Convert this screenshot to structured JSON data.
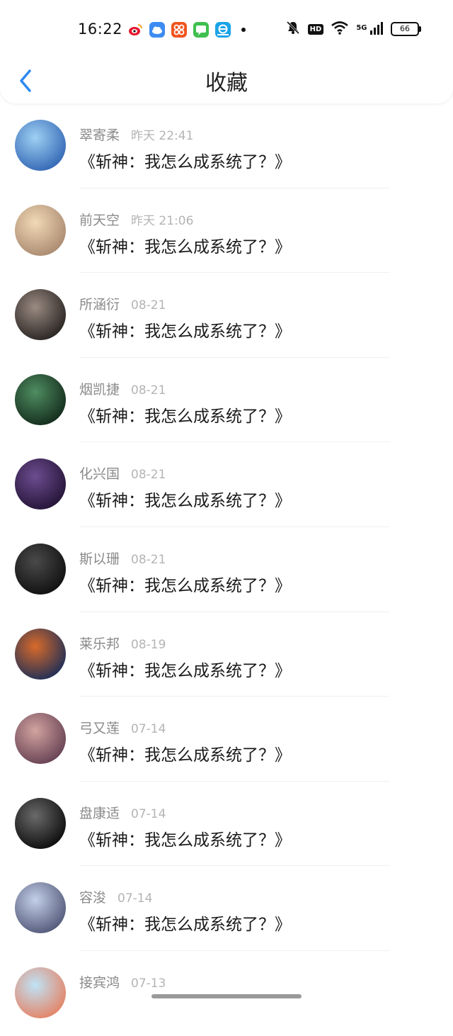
{
  "status_bar": {
    "time": "16:22",
    "hd_label": "HD",
    "network_label": "5G",
    "battery": "66"
  },
  "header": {
    "title": "收藏"
  },
  "items": [
    {
      "name": "翠寄柔",
      "date": "昨天 22:41",
      "message": "《斩神：我怎么成系统了？》",
      "avatar_colors": [
        "#9fd0f3",
        "#2a5fb0"
      ]
    },
    {
      "name": "前天空",
      "date": "昨天 21:06",
      "message": "《斩神：我怎么成系统了？》",
      "avatar_colors": [
        "#f1d9b6",
        "#a4836a"
      ]
    },
    {
      "name": "所涵衍",
      "date": "08-21",
      "message": "《斩神：我怎么成系统了？》",
      "avatar_colors": [
        "#9b8b82",
        "#1f1b1a"
      ]
    },
    {
      "name": "烟凯捷",
      "date": "08-21",
      "message": "《斩神：我怎么成系统了？》",
      "avatar_colors": [
        "#4f8d62",
        "#0f2416"
      ]
    },
    {
      "name": "化兴国",
      "date": "08-21",
      "message": "《斩神：我怎么成系统了？》",
      "avatar_colors": [
        "#6b4c8f",
        "#1f1030"
      ]
    },
    {
      "name": "斯以珊",
      "date": "08-21",
      "message": "《斩神：我怎么成系统了？》",
      "avatar_colors": [
        "#4a4a4a",
        "#0b0b0b"
      ]
    },
    {
      "name": "莱乐邦",
      "date": "08-19",
      "message": "《斩神：我怎么成系统了？》",
      "avatar_colors": [
        "#d86a2a",
        "#102a5a"
      ]
    },
    {
      "name": "弓又莲",
      "date": "07-14",
      "message": "《斩神：我怎么成系统了？》",
      "avatar_colors": [
        "#d2a3a0",
        "#5e3a4d"
      ]
    },
    {
      "name": "盘康适",
      "date": "07-14",
      "message": "《斩神：我怎么成系统了？》",
      "avatar_colors": [
        "#6a6a6a",
        "#050505"
      ]
    },
    {
      "name": "容浚",
      "date": "07-14",
      "message": "《斩神：我怎么成系统了？》",
      "avatar_colors": [
        "#c3cfe8",
        "#4a4f70"
      ]
    },
    {
      "name": "接宾鸿",
      "date": "07-13",
      "message": "",
      "avatar_colors": [
        "#bfe3f6",
        "#e77b5a"
      ]
    }
  ]
}
